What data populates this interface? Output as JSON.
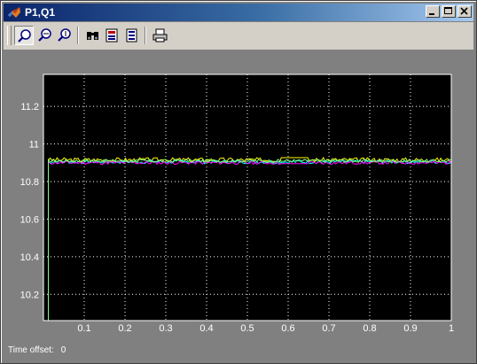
{
  "window": {
    "title": "P1,Q1",
    "buttons": {
      "minimize": "minimize",
      "maximize": "maximize",
      "close": "close"
    }
  },
  "toolbar": {
    "tools": [
      {
        "name": "zoom-icon",
        "pressed": true
      },
      {
        "name": "zoom-x-icon",
        "pressed": false
      },
      {
        "name": "zoom-y-icon",
        "pressed": false
      },
      {
        "name": "autoscale-icon",
        "pressed": false
      },
      {
        "name": "save-axes-settings-icon",
        "pressed": false
      },
      {
        "name": "scope-parameters-icon",
        "pressed": false
      },
      {
        "name": "print-icon",
        "pressed": false
      }
    ]
  },
  "status": {
    "time_offset_label": "Time offset:",
    "time_offset_value": "0"
  },
  "chart_data": {
    "type": "line",
    "xlim": [
      0,
      1
    ],
    "ylim": [
      10.06,
      11.37
    ],
    "x_ticks": [
      "0.1",
      "0.2",
      "0.3",
      "0.4",
      "0.5",
      "0.6",
      "0.7",
      "0.8",
      "0.9",
      "1"
    ],
    "y_ticks": [
      "10.2",
      "10.4",
      "10.6",
      "10.8",
      "11",
      "11.2"
    ],
    "grid": true,
    "background": "#000000",
    "series": [
      {
        "color": "#ffff00",
        "level": 10.915,
        "noise": 0.012,
        "seed": 3
      },
      {
        "color": "#00ffff",
        "level": 10.905,
        "noise": 0.01,
        "seed": 7
      },
      {
        "color": "#ff00ff",
        "level": 10.9,
        "noise": 0.009,
        "seed": 11
      },
      {
        "color": "#80ff80",
        "level": 10.91,
        "noise": 0.008,
        "seed": 17
      }
    ]
  }
}
